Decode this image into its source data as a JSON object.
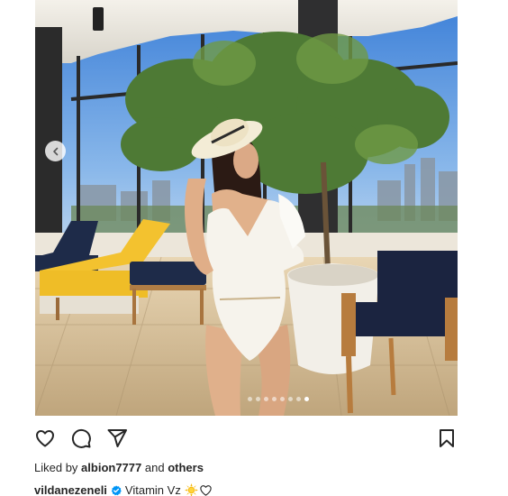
{
  "post": {
    "image_alt": "Woman in white swimsuit and straw hat on a rooftop terrace with lounge chairs and a potted tree",
    "carousel": {
      "total_slides": 8,
      "active_index": 7
    }
  },
  "actions": {
    "like_icon": "heart-icon",
    "comment_icon": "comment-icon",
    "share_icon": "send-icon",
    "save_icon": "bookmark-icon"
  },
  "likes": {
    "prefix": "Liked by",
    "user": "albion7777",
    "connector": "and",
    "others": "others"
  },
  "caption": {
    "username": "vildanezeneli",
    "text": "Vitamin Vz",
    "emojis": [
      "sun-emoji",
      "white-heart-emoji"
    ]
  },
  "colors": {
    "text": "#262626",
    "verified": "#0095f6",
    "towel": "#f2c12e",
    "cushion": "#1c2a4a"
  }
}
